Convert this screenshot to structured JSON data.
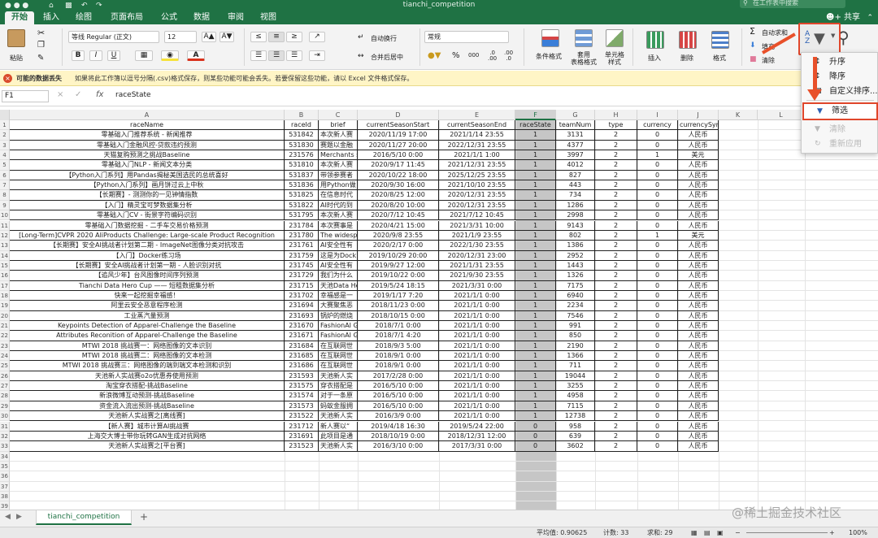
{
  "window": {
    "title": "tianchi_competition",
    "search_placeholder": "在工作表中搜索",
    "share_label": "共享"
  },
  "tabs": [
    "开始",
    "插入",
    "绘图",
    "页面布局",
    "公式",
    "数据",
    "审阅",
    "视图"
  ],
  "ribbon": {
    "paste": "粘贴",
    "font_name": "等线 Regular (正文)",
    "font_size": "12",
    "bold": "B",
    "italic": "I",
    "underline": "U",
    "grow": "A▲",
    "shrink": "A▼",
    "font_color": "A",
    "wrap": "自动换行",
    "merge": "合并后居中",
    "number_format": "常规",
    "percent": "%",
    "comma": "000",
    "cond_format": "条件格式",
    "table_format": "套用\n表格格式",
    "cell_style": "单元格\n样式",
    "insert": "插入",
    "delete": "删除",
    "format": "格式",
    "autosum": "自动求和",
    "fill": "填充",
    "clear": "清除",
    "sigma": "Σ"
  },
  "warning": {
    "title": "可能的数据丢失",
    "message": "如果将此工作簿以逗号分隔(.csv)格式保存，则某些功能可能会丢失。若要保留这些功能，请以 Excel 文件格式保存。"
  },
  "formula_bar": {
    "name_box": "F1",
    "fx": "fx",
    "cancel": "×",
    "confirm": "✓",
    "content": "raceState"
  },
  "columns": [
    "A",
    "B",
    "C",
    "D",
    "E",
    "F",
    "G",
    "H",
    "I",
    "J",
    "K",
    "L",
    "M"
  ],
  "headers": [
    "raceName",
    "raceId",
    "brief",
    "currentSeasonStart",
    "currentSeasonEnd",
    "raceState",
    "teamNum",
    "type",
    "currency",
    "currencySymbol"
  ],
  "rows": [
    [
      "零基础入门推荐系统 - 新闻推荐",
      "531842",
      "本次新人赛",
      "2020/11/19 17:00",
      "2021/1/14 23:55",
      "1",
      "3131",
      "2",
      "0",
      "人民币"
    ],
    [
      "零基础入门金融风控-贷款违约预测",
      "531830",
      "赛题以金融",
      "2020/11/27 20:00",
      "2022/12/31 23:55",
      "1",
      "4377",
      "2",
      "0",
      "人民币"
    ],
    [
      "天猫复购预测之挑战Baseline",
      "231576",
      "Merchants s",
      "2016/5/10 0:00",
      "2021/1/1 1:00",
      "1",
      "3997",
      "2",
      "1",
      "美元"
    ],
    [
      "零基础入门NLP - 新闻文本分类",
      "531810",
      "本次新人赛",
      "2020/9/17 11:45",
      "2021/12/31 23:55",
      "1",
      "4012",
      "2",
      "0",
      "人民币"
    ],
    [
      "【Python入门系列】用Pandas揭秘美国选民的总统喜好",
      "531837",
      "带领参赛者",
      "2020/10/22 18:00",
      "2025/12/25 23:55",
      "1",
      "827",
      "2",
      "0",
      "人民币"
    ],
    [
      "【Python入门系列】画月饼过云上中秋",
      "531836",
      "用Python做",
      "2020/9/30 16:00",
      "2021/10/10 23:55",
      "1",
      "443",
      "2",
      "0",
      "人民币"
    ],
    [
      "【长期赛】- 测测你的一见钟情指数",
      "531825",
      "在信息时代",
      "2020/8/25 12:00",
      "2020/12/31 23:55",
      "1",
      "734",
      "2",
      "0",
      "人民币"
    ],
    [
      "【入门】精灵宝可梦数据集分析",
      "531822",
      "AI时代的到",
      "2020/8/20 10:00",
      "2020/12/31 23:55",
      "1",
      "1286",
      "2",
      "0",
      "人民币"
    ],
    [
      "零基础入门CV - 街景字符编码识别",
      "531795",
      "本次新人赛",
      "2020/7/12 10:45",
      "2021/7/12 10:45",
      "1",
      "2998",
      "2",
      "0",
      "人民币"
    ],
    [
      "零基础入门数据挖掘 - 二手车交易价格预测",
      "231784",
      "本次赛事是",
      "2020/4/21 15:00",
      "2021/3/31 10:00",
      "1",
      "9143",
      "2",
      "0",
      "人民币"
    ],
    [
      "[Long-Term]CVPR 2020 AliProducts Challenge: Large-scale Product Recognition",
      "231780",
      "The widespr",
      "2020/9/8 23:55",
      "2021/1/9 23:55",
      "1",
      "802",
      "2",
      "1",
      "美元"
    ],
    [
      "【长期赛】安全AI挑战者计划第二期 - ImageNet图像分类对抗攻击",
      "231761",
      "AI安全性有",
      "2020/2/17 0:00",
      "2022/1/30 23:55",
      "1",
      "1386",
      "2",
      "0",
      "人民币"
    ],
    [
      "【入门】Docker练习场",
      "231759",
      "这是为Dock",
      "2019/10/29 20:00",
      "2020/12/31 23:00",
      "1",
      "2952",
      "2",
      "0",
      "人民币"
    ],
    [
      "【长期赛】安全AI挑战者计划第一期 - 人脸识别对抗",
      "231745",
      "AI安全性有",
      "2019/9/27 12:00",
      "2021/1/31 23:55",
      "1",
      "1443",
      "2",
      "0",
      "人民币"
    ],
    [
      "【追风少年】台风图像时间序列预测",
      "231729",
      "我们为什么",
      "2019/10/22 0:00",
      "2021/9/30 23:55",
      "1",
      "1326",
      "2",
      "0",
      "人民币"
    ],
    [
      "Tianchi Data Hero Cup —— 短租数据集分析",
      "231715",
      "天池Data He",
      "2019/5/24 18:15",
      "2021/3/31 0:00",
      "1",
      "7175",
      "2",
      "0",
      "人民币"
    ],
    [
      "快来一起挖掘幸福感！",
      "231702",
      "幸福感是一",
      "2019/1/17 7:20",
      "2021/1/1 0:00",
      "1",
      "6940",
      "2",
      "0",
      "人民币"
    ],
    [
      "阿里云安全恶意程序检测",
      "231694",
      "大赛聚焦恶",
      "2018/11/23 0:00",
      "2021/1/1 0:00",
      "1",
      "2234",
      "2",
      "0",
      "人民币"
    ],
    [
      "工业蒸汽量预测",
      "231693",
      "锅炉的燃烧",
      "2018/10/15 0:00",
      "2021/1/1 0:00",
      "1",
      "7546",
      "2",
      "0",
      "人民币"
    ],
    [
      "Keypoints Detection of Apparel-Challenge the Baseline",
      "231670",
      "FashionAI G",
      "2018/7/1 0:00",
      "2021/1/1 0:00",
      "1",
      "991",
      "2",
      "0",
      "人民币"
    ],
    [
      "Attributes Reconition of Apparel-Challenge the Baseline",
      "231671",
      "FashionAI G",
      "2018/7/1 4:20",
      "2021/1/1 0:00",
      "1",
      "850",
      "2",
      "0",
      "人民币"
    ],
    [
      "MTWI 2018 挑战赛一：网络图像的文本识别",
      "231684",
      "在互联网世",
      "2018/9/3 5:00",
      "2021/1/1 0:00",
      "1",
      "2190",
      "2",
      "0",
      "人民币"
    ],
    [
      "MTWI 2018 挑战赛二：网络图像的文本检测",
      "231685",
      "在互联网世",
      "2018/9/1 0:00",
      "2021/1/1 0:00",
      "1",
      "1366",
      "2",
      "0",
      "人民币"
    ],
    [
      "MTWI 2018 挑战赛三：网络图像的端到端文本检测和识别",
      "231686",
      "在互联网世",
      "2018/9/1 0:00",
      "2021/1/1 0:00",
      "1",
      "711",
      "2",
      "0",
      "人民币"
    ],
    [
      "天池新人实战赛o2o优惠券使用预测",
      "231593",
      "天池新人实",
      "2017/2/28 0:00",
      "2021/1/1 0:00",
      "1",
      "19044",
      "2",
      "0",
      "人民币"
    ],
    [
      "淘宝穿衣搭配-挑战Baseline",
      "231575",
      "穿衣搭配是",
      "2016/5/10 0:00",
      "2021/1/1 0:00",
      "1",
      "3255",
      "2",
      "0",
      "人民币"
    ],
    [
      "新浪微博互动预测-挑战Baseline",
      "231574",
      "对于一条原",
      "2016/5/10 0:00",
      "2021/1/1 0:00",
      "1",
      "4958",
      "2",
      "0",
      "人民币"
    ],
    [
      "资金流入流出预测-挑战Baseline",
      "231573",
      "蚂蚁金服拥",
      "2016/5/10 0:00",
      "2021/1/1 0:00",
      "1",
      "7115",
      "2",
      "0",
      "人民币"
    ],
    [
      "天池新人实战赛之[离线赛]",
      "231522",
      "天池新人实",
      "2016/3/9 0:00",
      "2021/1/1 0:00",
      "1",
      "12738",
      "2",
      "0",
      "人民币"
    ],
    [
      "【新人赛】城市计算AI挑战赛",
      "231712",
      "新人赛以“",
      "2019/4/18 16:30",
      "2019/5/24 22:00",
      "0",
      "958",
      "2",
      "0",
      "人民币"
    ],
    [
      "上海交大博士带你玩转GAN生成对抗网络",
      "231691",
      "此项目是通",
      "2018/10/19 0:00",
      "2018/12/31 12:00",
      "0",
      "639",
      "2",
      "0",
      "人民币"
    ],
    [
      "天池新人实战赛之[平台赛]",
      "231523",
      "天池新人实",
      "2016/3/10 0:00",
      "2017/3/31 0:00",
      "0",
      "3602",
      "2",
      "0",
      "人民币"
    ]
  ],
  "row_numbers": [
    "1",
    "2",
    "3",
    "4",
    "5",
    "6",
    "7",
    "8",
    "9",
    "10",
    "11",
    "12",
    "13",
    "14",
    "15",
    "16",
    "17",
    "18",
    "19",
    "20",
    "21",
    "22",
    "23",
    "24",
    "25",
    "26",
    "27",
    "28",
    "29",
    "30",
    "31",
    "32",
    "33",
    "34",
    "35",
    "36",
    "37",
    "38",
    "39"
  ],
  "dropdown": {
    "sort_asc": "升序",
    "sort_desc": "降序",
    "custom_sort": "自定义排序...",
    "filter": "筛选",
    "clear": "清除",
    "reapply": "重新应用"
  },
  "sheet": {
    "name": "tianchi_competition",
    "add": "+"
  },
  "status": {
    "average": "平均值: 0.90625",
    "count": "计数: 33",
    "sum": "求和: 29",
    "zoom": "100%"
  },
  "watermark": "@稀土掘金技术社区",
  "colors": {
    "excel_green": "#1f7244",
    "highlight_red": "#e0462b",
    "warning_bg": "#fff5c6"
  }
}
